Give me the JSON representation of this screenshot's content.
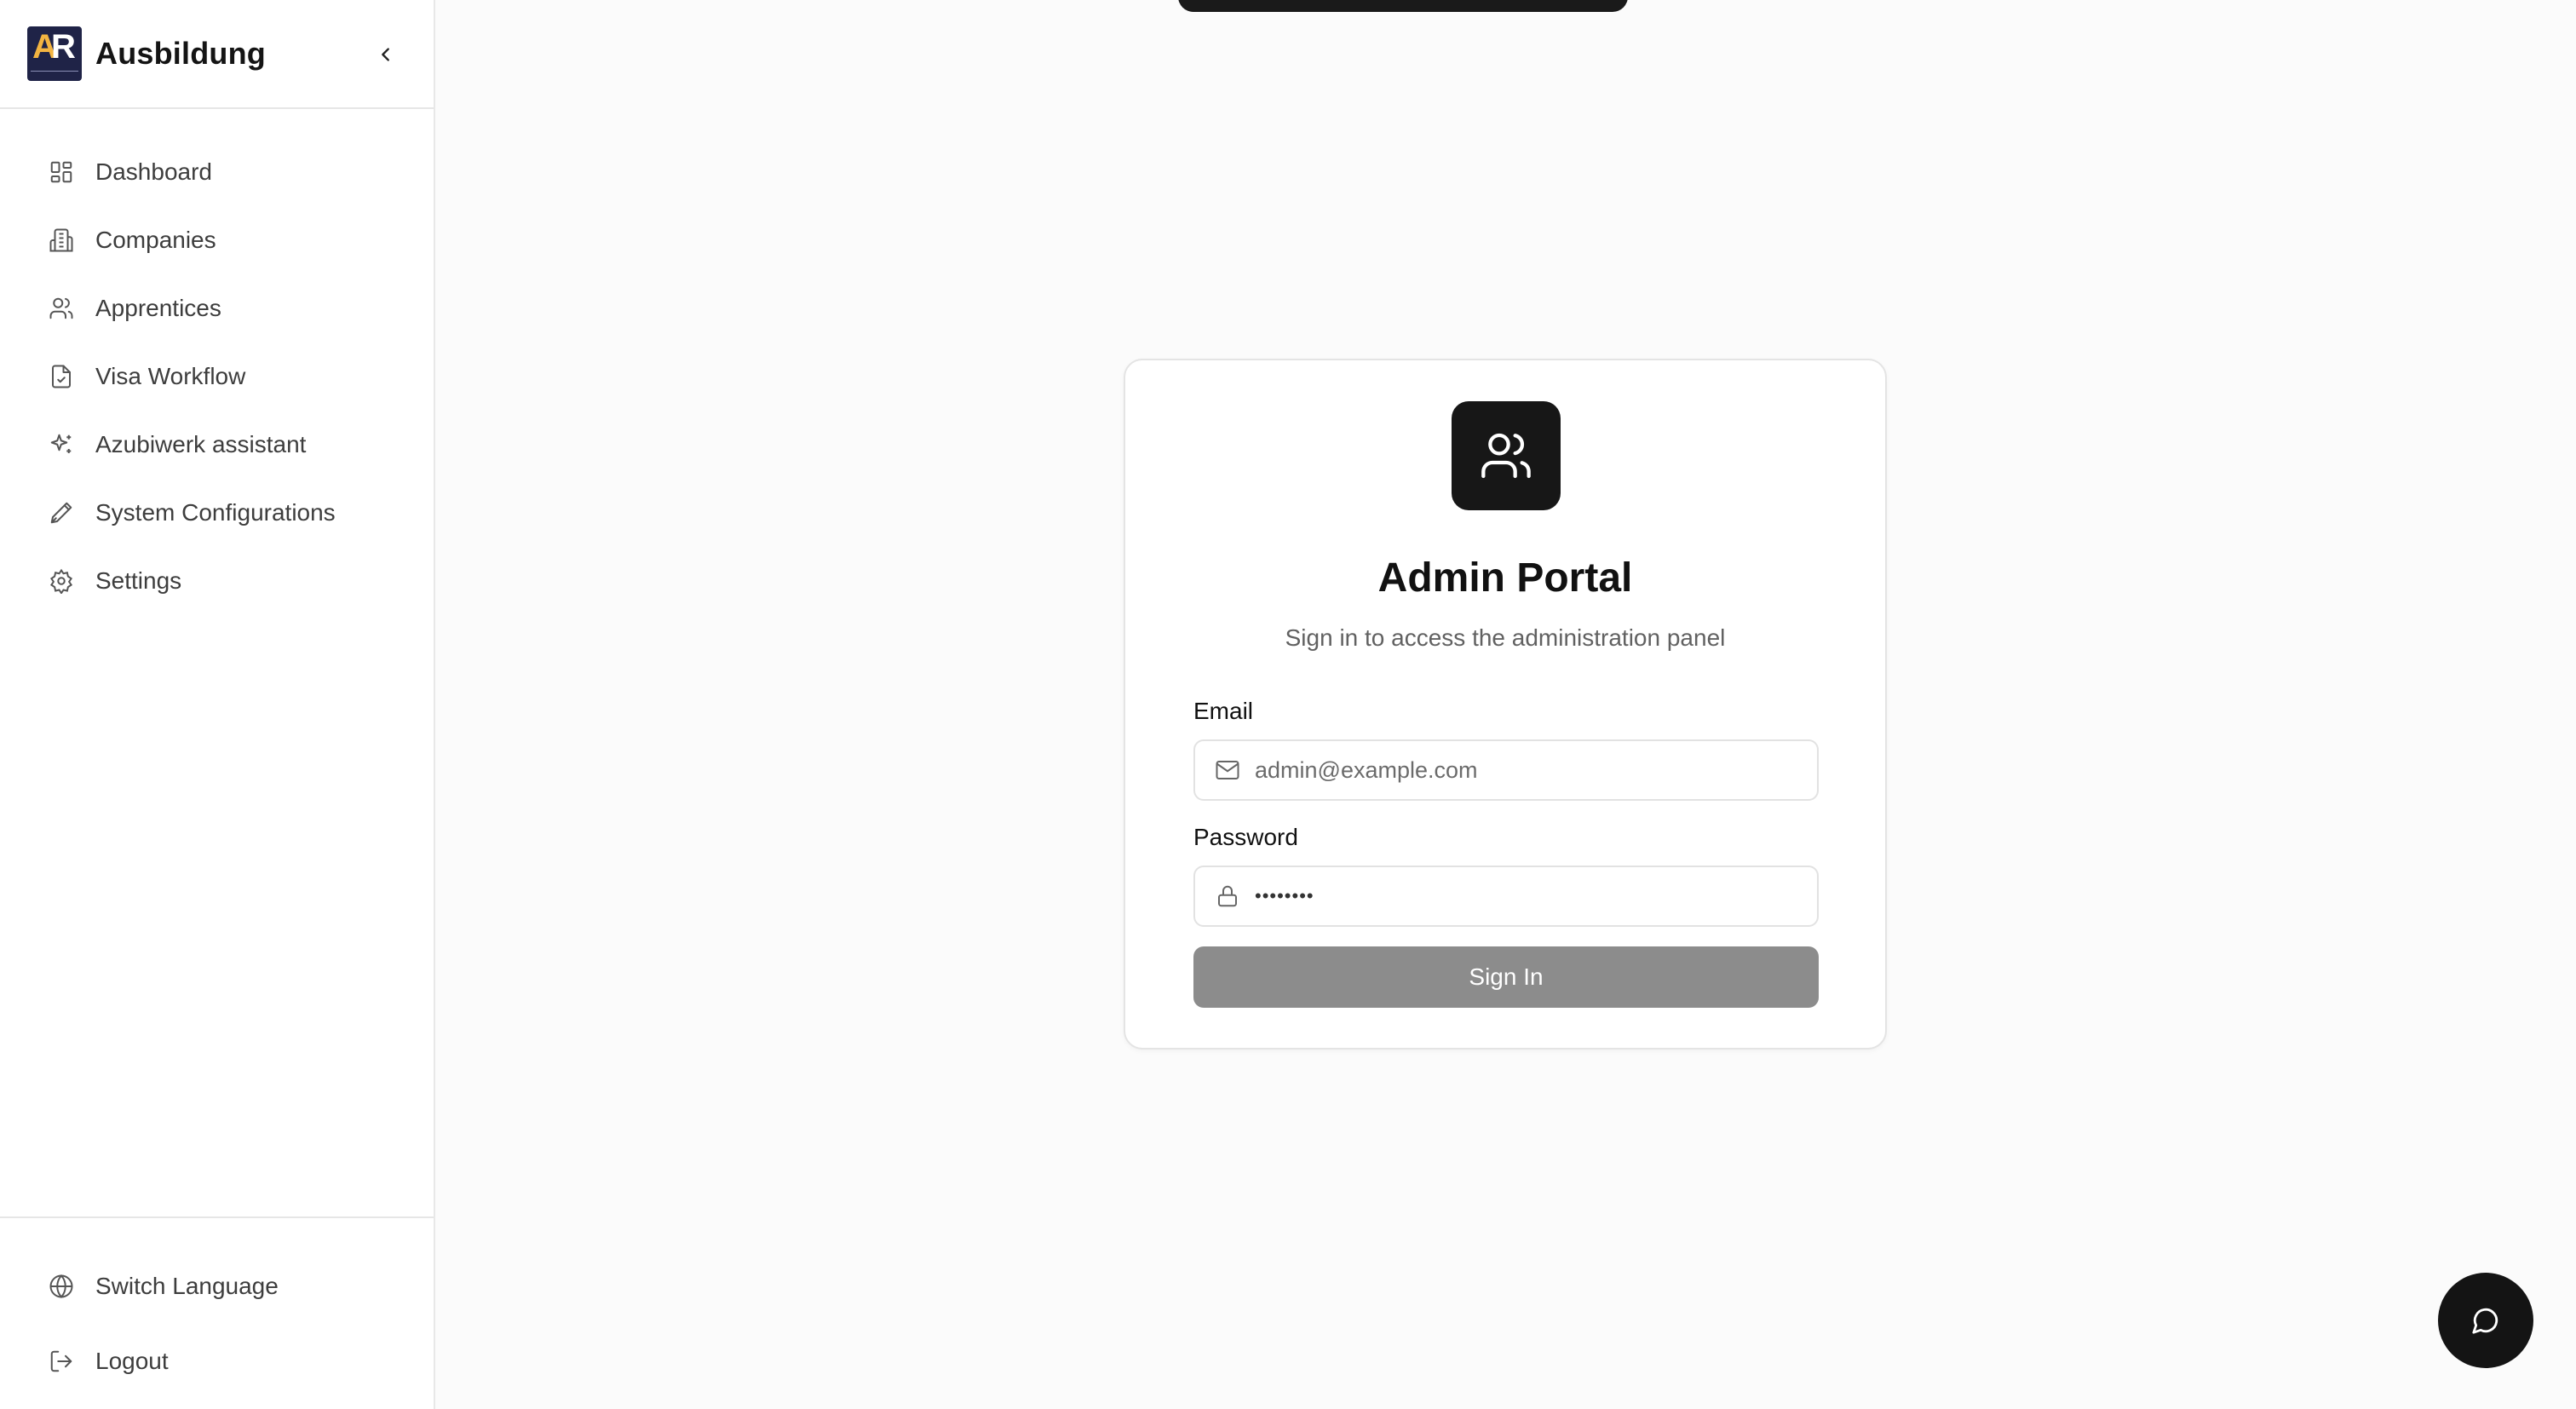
{
  "sidebar": {
    "brand": "Ausbildung",
    "logo_letters": {
      "a": "A",
      "r": "R"
    },
    "items": [
      {
        "label": "Dashboard",
        "icon": "dashboard-icon"
      },
      {
        "label": "Companies",
        "icon": "building-icon"
      },
      {
        "label": "Apprentices",
        "icon": "users-icon"
      },
      {
        "label": "Visa Workflow",
        "icon": "file-check-icon"
      },
      {
        "label": "Azubiwerk assistant",
        "icon": "sparkles-icon"
      },
      {
        "label": "System Configurations",
        "icon": "pen-icon"
      },
      {
        "label": "Settings",
        "icon": "gear-icon"
      }
    ],
    "footer": [
      {
        "label": "Switch Language",
        "icon": "globe-icon"
      },
      {
        "label": "Logout",
        "icon": "logout-icon"
      }
    ]
  },
  "login": {
    "title": "Admin Portal",
    "subtitle": "Sign in to access the administration panel",
    "email_label": "Email",
    "email_placeholder": "admin@example.com",
    "password_label": "Password",
    "password_value": "••••••••",
    "submit_label": "Sign In"
  },
  "colors": {
    "accent_dark": "#171717",
    "button_disabled": "#8c8c8c",
    "logo_bg": "#1f2347",
    "logo_accent": "#f3b441"
  }
}
